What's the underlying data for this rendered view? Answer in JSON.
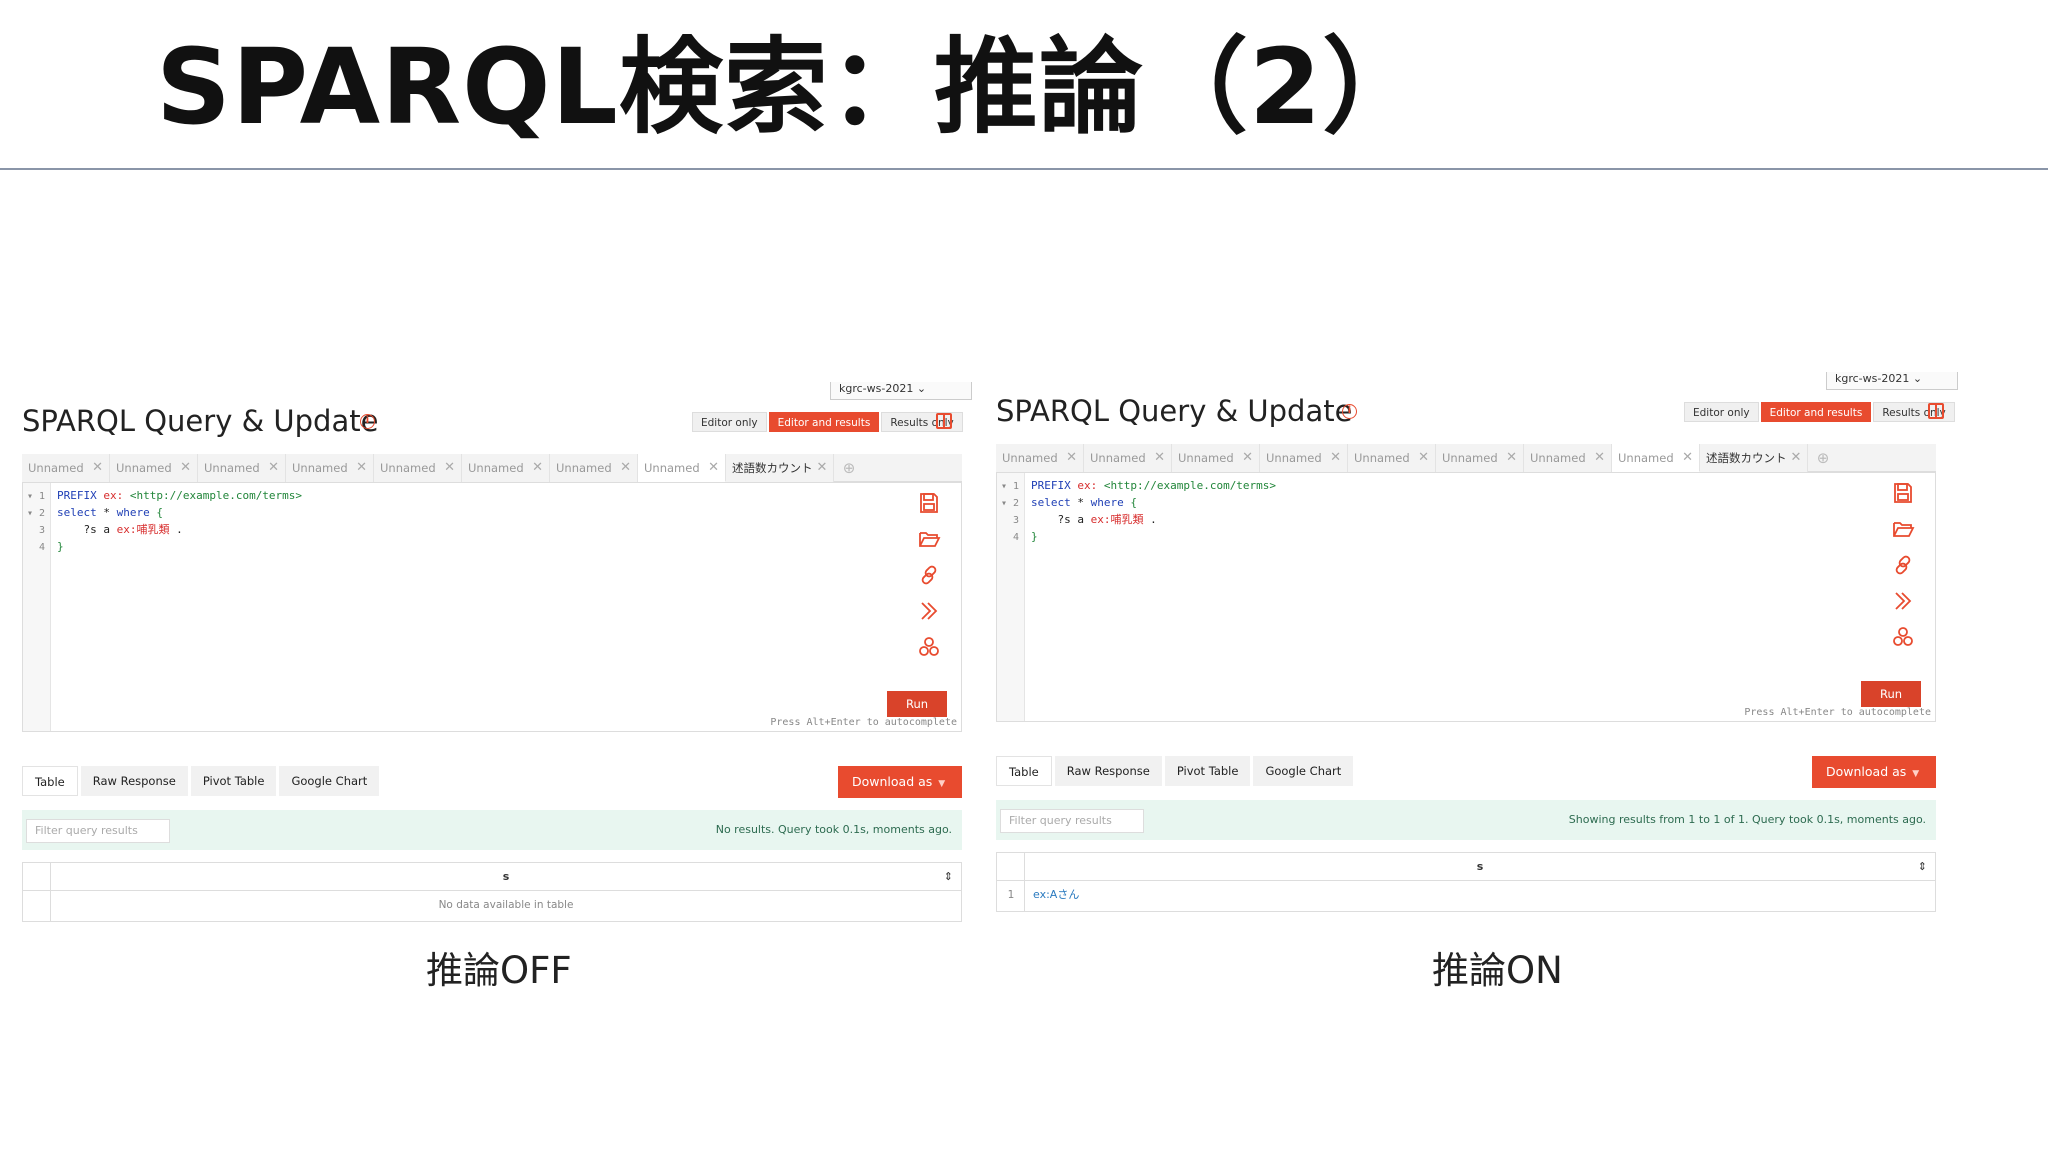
{
  "slide": {
    "title": "SPARQL検索：推論（2）",
    "captions": [
      "推論OFF",
      "推論ON"
    ]
  },
  "app": {
    "repo": "kgrc-ws-2021",
    "title": "SPARQL Query & Update",
    "modes": [
      "Editor only",
      "Editor and results",
      "Results only"
    ],
    "active_mode": "Editor and results",
    "tabs": [
      "Unnamed",
      "Unnamed",
      "Unnamed",
      "Unnamed",
      "Unnamed",
      "Unnamed",
      "Unnamed",
      "Unnamed",
      "述語数カウント"
    ],
    "active_tab_index": 7,
    "query_lines": [
      {
        "no": "1",
        "fold": "▾",
        "parts": [
          [
            "kw",
            "PREFIX "
          ],
          [
            "pref",
            "ex: "
          ],
          [
            "iri",
            "<http://example.com/terms>"
          ]
        ]
      },
      {
        "no": "2",
        "fold": "▾",
        "parts": [
          [
            "kw",
            "select "
          ],
          [
            "",
            "* "
          ],
          [
            "kw",
            "where "
          ],
          [
            "brace",
            "{"
          ]
        ]
      },
      {
        "no": "3",
        "fold": "",
        "parts": [
          [
            "",
            "    ?s a "
          ],
          [
            "pn",
            "ex:哺乳類"
          ],
          [
            "",
            " ."
          ]
        ]
      },
      {
        "no": "4",
        "fold": "",
        "parts": [
          [
            "brace",
            "}"
          ]
        ]
      }
    ],
    "run_label": "Run",
    "hint": "Press Alt+Enter to autocomplete",
    "result_tabs": [
      "Table",
      "Raw Response",
      "Pivot Table",
      "Google Chart"
    ],
    "download_label": "Download as",
    "filter_placeholder": "Filter query results",
    "column": "s",
    "sort_icon": "⇕"
  },
  "left": {
    "status": "No results. Query took 0.1s, moments ago.",
    "empty": "No data available in table"
  },
  "right": {
    "status": "Showing results from 1 to 1 of 1. Query took 0.1s, moments ago.",
    "rows": [
      {
        "index": "1",
        "s": "ex:Aさん"
      }
    ]
  },
  "colors": {
    "accent": "#e84b2f",
    "status_bg": "#e8f6f0",
    "link": "#2a7abf"
  },
  "icons": [
    "info-icon",
    "layout-toggle-icon",
    "save-icon",
    "folder-open-icon",
    "link-icon",
    "double-chevron-right-icon",
    "cluster-icon",
    "tab-close-icon",
    "tab-add-icon",
    "sort-icon",
    "caret-down-icon"
  ]
}
